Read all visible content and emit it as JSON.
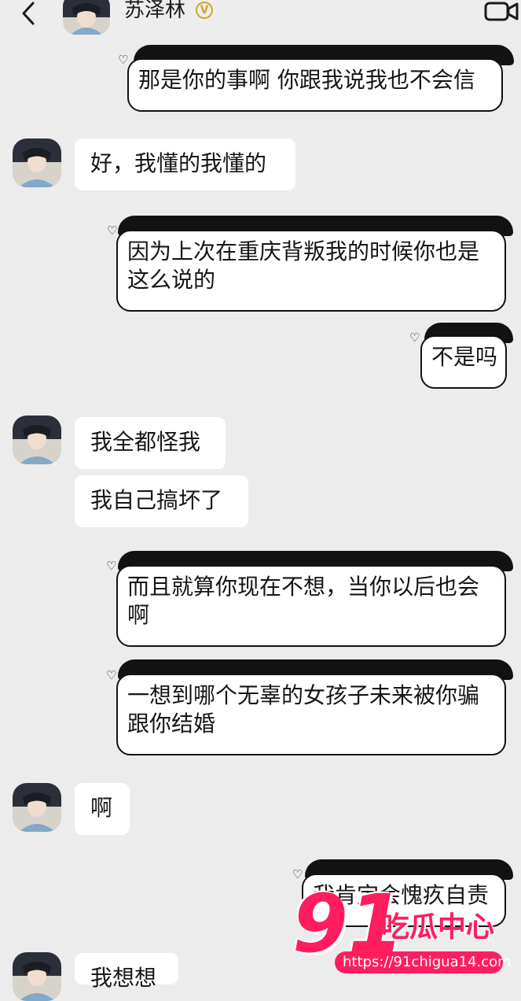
{
  "header": {
    "contact_name": "苏泽林",
    "verified_badge": "V",
    "back_icon": "chevron-left-icon",
    "video_icon": "video-camera-icon"
  },
  "messages": [
    {
      "side": "right",
      "text": "那是你的事啊  你跟我说我也不会信"
    },
    {
      "side": "left",
      "text": "好，我懂的我懂的"
    },
    {
      "side": "right",
      "text": "因为上次在重庆背叛我的时候你也是这么说的"
    },
    {
      "side": "right",
      "text": "不是吗"
    },
    {
      "side": "left",
      "text": "我全都怪我"
    },
    {
      "side": "left",
      "text": "我自己搞坏了"
    },
    {
      "side": "right",
      "text": "而且就算你现在不想，当你以后也会啊"
    },
    {
      "side": "right",
      "text": "一想到哪个无辜的女孩子未来被你骗跟你结婚"
    },
    {
      "side": "left",
      "text": "啊"
    },
    {
      "side": "right",
      "text": "我肯定会愧疚自责"
    },
    {
      "side": "left",
      "text": "我想想"
    }
  ],
  "watermark": {
    "number": "91",
    "title": "吃瓜中心",
    "url": "https://91chigua14.com"
  },
  "colors": {
    "background": "#ececec",
    "bubble_left": "#ffffff",
    "bubble_right_outline": "#121212",
    "watermark": "#ff1d5e",
    "verified": "#d8a22b"
  }
}
